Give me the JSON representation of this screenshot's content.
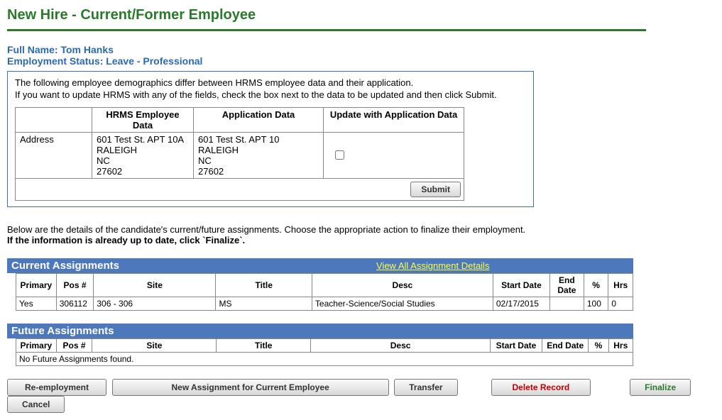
{
  "page": {
    "title": "New Hire - Current/Former Employee"
  },
  "identity": {
    "name_label": "Full Name:",
    "name_value": "Tom Hanks",
    "status_label": "Employment Status:",
    "status_value": "Leave - Professional"
  },
  "compare": {
    "line1": "The following employee demographics differ between HRMS employee data and their application.",
    "line2": "If you want to update HRMS with any of the fields, check the box next to the data to be updated and then click Submit.",
    "col_field": "",
    "col_hrms": "HRMS Employee Data",
    "col_app": "Application Data",
    "col_update": "Update with Application Data",
    "row_label": "Address",
    "hrms_l1": "601 Test St. APT 10A",
    "hrms_l2": "RALEIGH",
    "hrms_l3": "NC",
    "hrms_l4": "27602",
    "app_l1": "601 Test St. APT 10",
    "app_l2": "RALEIGH",
    "app_l3": "NC",
    "app_l4": "27602",
    "submit_label": "Submit"
  },
  "note": {
    "line1": "Below are the details of the candidate's current/future assignments. Choose the appropriate action to finalize their employment.",
    "line2": "If the information is already up to date, click `Finalize`."
  },
  "current": {
    "title": "Current Assignments",
    "view_link": "View All Assignment Details",
    "headers": {
      "primary": "Primary",
      "pos": "Pos #",
      "site": "Site",
      "title": "Title",
      "desc": "Desc",
      "start": "Start Date",
      "end": "End Date",
      "pct": "%",
      "hrs": "Hrs"
    },
    "rows": [
      {
        "primary": "Yes",
        "pos": "306112",
        "site": "306 - 306",
        "title": "MS",
        "desc": "Teacher-Science/Social Studies",
        "start": "02/17/2015",
        "end": "",
        "pct": "100",
        "hrs": "0"
      }
    ]
  },
  "future": {
    "title": "Future Assignments",
    "headers": {
      "primary": "Primary",
      "pos": "Pos #",
      "site": "Site",
      "title": "Title",
      "desc": "Desc",
      "start": "Start Date",
      "end": "End Date",
      "pct": "%",
      "hrs": "Hrs"
    },
    "empty_msg": "No Future Assignments found."
  },
  "buttons": {
    "reemployment": "Re-employment",
    "new_assignment": "New Assignment for Current Employee",
    "transfer": "Transfer",
    "delete": "Delete Record",
    "finalize": "Finalize",
    "cancel": "Cancel"
  }
}
